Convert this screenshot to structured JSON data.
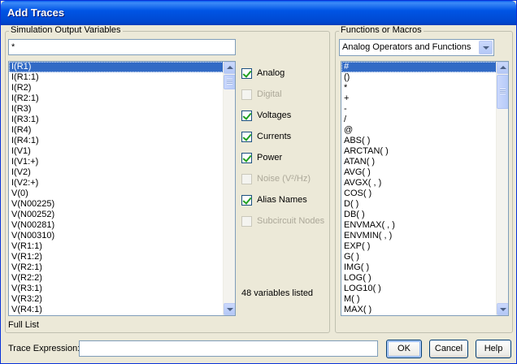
{
  "window": {
    "title": "Add Traces"
  },
  "left_group": {
    "label": "Simulation Output Variables",
    "filter_value": "*",
    "variables": [
      "I(R1)",
      "I(R1:1)",
      "I(R2)",
      "I(R2:1)",
      "I(R3)",
      "I(R3:1)",
      "I(R4)",
      "I(R4:1)",
      "I(V1)",
      "I(V1:+)",
      "I(V2)",
      "I(V2:+)",
      "V(0)",
      "V(N00225)",
      "V(N00252)",
      "V(N00281)",
      "V(N00310)",
      "V(R1:1)",
      "V(R1:2)",
      "V(R2:1)",
      "V(R2:2)",
      "V(R3:1)",
      "V(R3:2)",
      "V(R4:1)"
    ],
    "selected_index": 0,
    "footer": "Full List"
  },
  "options": {
    "items": [
      {
        "label": "Analog",
        "checked": true,
        "enabled": true
      },
      {
        "label": "Digital",
        "checked": false,
        "enabled": false
      },
      {
        "label": "Voltages",
        "checked": true,
        "enabled": true
      },
      {
        "label": "Currents",
        "checked": true,
        "enabled": true
      },
      {
        "label": "Power",
        "checked": true,
        "enabled": true
      },
      {
        "label": "Noise (V²/Hz)",
        "checked": false,
        "enabled": false
      },
      {
        "label": "Alias Names",
        "checked": true,
        "enabled": true
      },
      {
        "label": "Subcircuit Nodes",
        "checked": false,
        "enabled": false
      }
    ],
    "count_text": "48 variables listed"
  },
  "right_group": {
    "label": "Functions or Macros",
    "dropdown_value": "Analog Operators and Functions",
    "functions": [
      "#",
      "()",
      "*",
      "+",
      "-",
      "/",
      "@",
      "ABS( )",
      "ARCTAN( )",
      "ATAN( )",
      "AVG( )",
      "AVGX( , )",
      "COS( )",
      "D( )",
      "DB( )",
      "ENVMAX( , )",
      "ENVMIN( , )",
      "EXP( )",
      "G( )",
      "IMG( )",
      "LOG( )",
      "LOG10( )",
      "M( )",
      "MAX( )"
    ],
    "selected_index": 0
  },
  "bottom": {
    "trace_label": "Trace Expression:",
    "trace_value": "",
    "ok": "OK",
    "cancel": "Cancel",
    "help": "Help"
  }
}
